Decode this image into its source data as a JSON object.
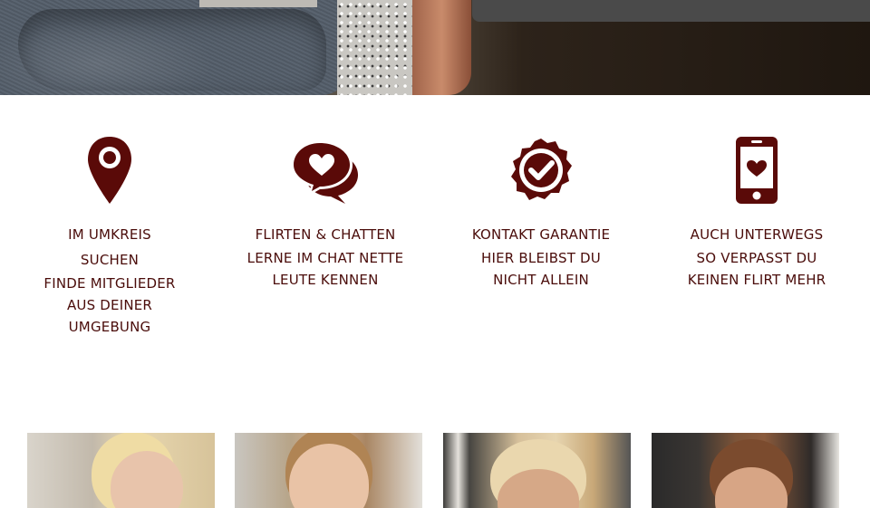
{
  "hero": {
    "description": ""
  },
  "features": [
    {
      "icon": "map-pin-icon",
      "title": "IM UMKREIS SUCHEN",
      "description": "FINDE MITGLIEDER AUS DEINER UMGEBUNG"
    },
    {
      "icon": "chat-heart-icon",
      "title": "FLIRTEN & CHATTEN",
      "description": "LERNE IM CHAT NETTE LEUTE KENNEN"
    },
    {
      "icon": "badge-check-icon",
      "title": "KONTAKT GARANTIE",
      "description": "HIER BLEIBST DU NICHT ALLEIN"
    },
    {
      "icon": "phone-heart-icon",
      "title": "AUCH UNTERWEGS",
      "description": "SO VERPASST DU KEINEN FLIRT MEHR"
    }
  ],
  "colors": {
    "accent": "#5a0a08",
    "text": "#4a0c0a"
  },
  "profiles": [
    {
      "name": ""
    },
    {
      "name": ""
    },
    {
      "name": ""
    },
    {
      "name": ""
    }
  ]
}
